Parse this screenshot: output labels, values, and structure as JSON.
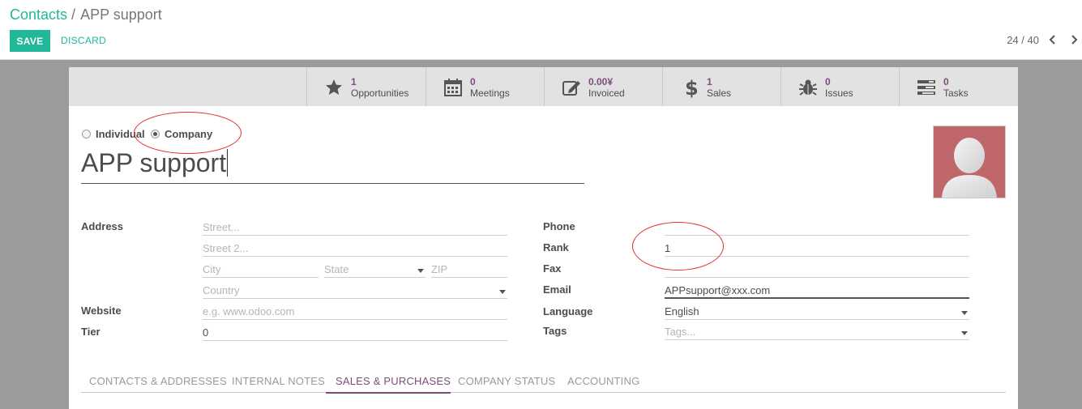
{
  "breadcrumb": {
    "parent": "Contacts",
    "separator": "/",
    "current": "APP support"
  },
  "toolbar": {
    "save_label": "SAVE",
    "discard_label": "DISCARD"
  },
  "pager": {
    "value": "24 / 40"
  },
  "smart_buttons": [
    {
      "value": "1",
      "label": "Opportunities",
      "icon": "star-icon"
    },
    {
      "value": "0",
      "label": "Meetings",
      "icon": "calendar-icon"
    },
    {
      "value": "0.00¥",
      "label": "Invoiced",
      "icon": "edit-icon"
    },
    {
      "value": "1",
      "label": "Sales",
      "icon": "dollar-icon"
    },
    {
      "value": "0",
      "label": "Issues",
      "icon": "bug-icon"
    },
    {
      "value": "0",
      "label": "Tasks",
      "icon": "tasks-icon"
    }
  ],
  "company_type": {
    "individual": "Individual",
    "company": "Company",
    "selected": "Company"
  },
  "name": "APP support",
  "left": {
    "address_label": "Address",
    "street_ph": "Street...",
    "street2_ph": "Street 2...",
    "city_ph": "City",
    "state_ph": "State",
    "zip_ph": "ZIP",
    "country_ph": "Country",
    "website_label": "Website",
    "website_ph": "e.g. www.odoo.com",
    "tier_label": "Tier",
    "tier_value": "0"
  },
  "right": {
    "phone_label": "Phone",
    "rank_label": "Rank",
    "rank_value": "1",
    "fax_label": "Fax",
    "email_label": "Email",
    "email_value": "APPsupport@xxx.com",
    "language_label": "Language",
    "language_value": "English",
    "tags_label": "Tags",
    "tags_ph": "Tags..."
  },
  "tabs": [
    "CONTACTS & ADDRESSES",
    "INTERNAL NOTES",
    "SALES & PURCHASES",
    "COMPANY STATUS",
    "ACCOUNTING"
  ],
  "active_tab": "SALES & PURCHASES",
  "colors": {
    "primary": "#21b799",
    "accent": "#7c4d7c",
    "annotation": "#e03030",
    "avatar_bg": "#c0676b"
  }
}
